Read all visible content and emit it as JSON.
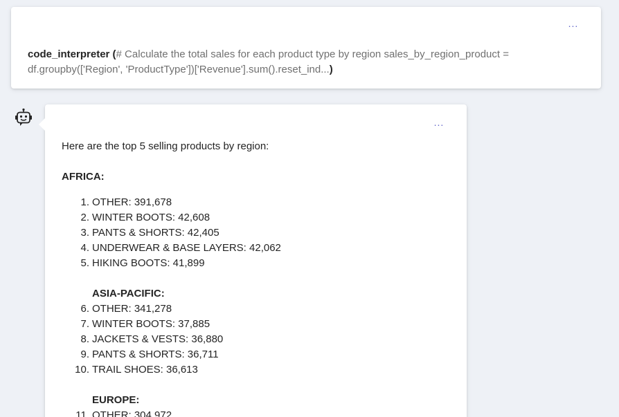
{
  "tool_call": {
    "name": "code_interpreter",
    "open_paren": "(",
    "args": "# Calculate the total sales for each product type by region sales_by_region_product = df.groupby(['Region', 'ProductType'])['Revenue'].sum().reset_ind...",
    "close_paren": ")",
    "more_label": "..."
  },
  "message": {
    "more_label": "...",
    "intro": "Here are the top 5 selling products by region:",
    "regions": [
      {
        "name": "AFRICA:",
        "items": [
          {
            "num": "1.",
            "text": "OTHER: 391,678"
          },
          {
            "num": "2.",
            "text": "WINTER BOOTS: 42,608"
          },
          {
            "num": "3.",
            "text": "PANTS & SHORTS: 42,405"
          },
          {
            "num": "4.",
            "text": "UNDERWEAR & BASE LAYERS: 42,062"
          },
          {
            "num": "5.",
            "text": "HIKING BOOTS: 41,899"
          }
        ]
      },
      {
        "name": "ASIA-PACIFIC:",
        "items": [
          {
            "num": "6.",
            "text": "OTHER: 341,278"
          },
          {
            "num": "7.",
            "text": "WINTER BOOTS: 37,885"
          },
          {
            "num": "8.",
            "text": "JACKETS & VESTS: 36,880"
          },
          {
            "num": "9.",
            "text": "PANTS & SHORTS: 36,711"
          },
          {
            "num": "10.",
            "text": "TRAIL SHOES: 36,613"
          }
        ]
      },
      {
        "name": "EUROPE:",
        "items": [
          {
            "num": "11.",
            "text": "OTHER: 304,972"
          }
        ]
      }
    ]
  },
  "icons": {
    "bot": "bot-icon",
    "more": "more-horizontal-icon"
  },
  "colors": {
    "background": "#eef1f6",
    "card": "#ffffff",
    "accent": "#5b5fc7",
    "muted_text": "#707070"
  }
}
